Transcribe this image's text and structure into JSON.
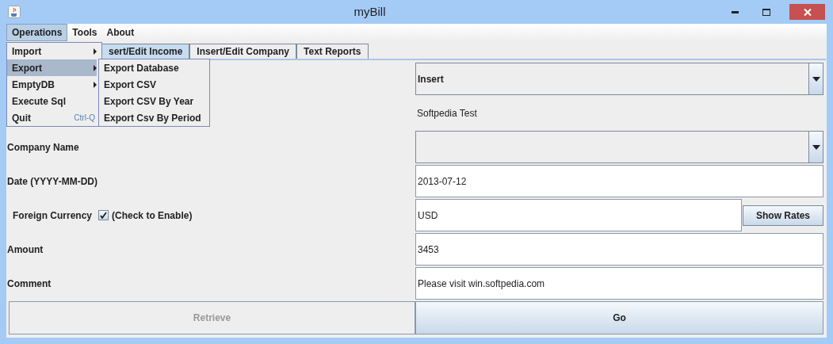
{
  "window": {
    "title": "myBill"
  },
  "menu_bar": [
    {
      "label": "Operations",
      "selected": true
    },
    {
      "label": "Tools",
      "selected": false
    },
    {
      "label": "About",
      "selected": false
    }
  ],
  "open_menu": [
    {
      "label": "Import",
      "submenu": true,
      "selected": false
    },
    {
      "label": "Export",
      "submenu": true,
      "selected": true
    },
    {
      "label": "EmptyDB",
      "submenu": true,
      "selected": false
    },
    {
      "label": "Execute Sql",
      "submenu": false,
      "selected": false
    },
    {
      "label": "Quit",
      "shortcut": "Ctrl-Q",
      "submenu": false,
      "selected": false
    }
  ],
  "submenu": [
    "Export Database",
    "Export CSV",
    "Export CSV By Year",
    "Export Csv By Period"
  ],
  "tabs": [
    {
      "label": "sert/Edit Income",
      "selected": true
    },
    {
      "label": "Insert/Edit Company",
      "selected": false
    },
    {
      "label": "Text Reports",
      "selected": false
    }
  ],
  "form": {
    "mode": "Insert",
    "company_display": "Softpedia Test",
    "company_name": {
      "label": "Company Name"
    },
    "date": {
      "label": "Date (YYYY-MM-DD)",
      "value": "2013-07-12"
    },
    "foreign_currency": {
      "label": "Foreign Currency",
      "checked": true,
      "hint": "(Check to Enable)",
      "value": "USD",
      "button": "Show Rates"
    },
    "amount": {
      "label": "Amount",
      "value": "3453"
    },
    "comment": {
      "label": "Comment",
      "value": "Please visit win.softpedia.com"
    }
  },
  "buttons": [
    {
      "label": "Retrieve",
      "disabled": true
    },
    {
      "label": "Go",
      "disabled": false
    }
  ]
}
